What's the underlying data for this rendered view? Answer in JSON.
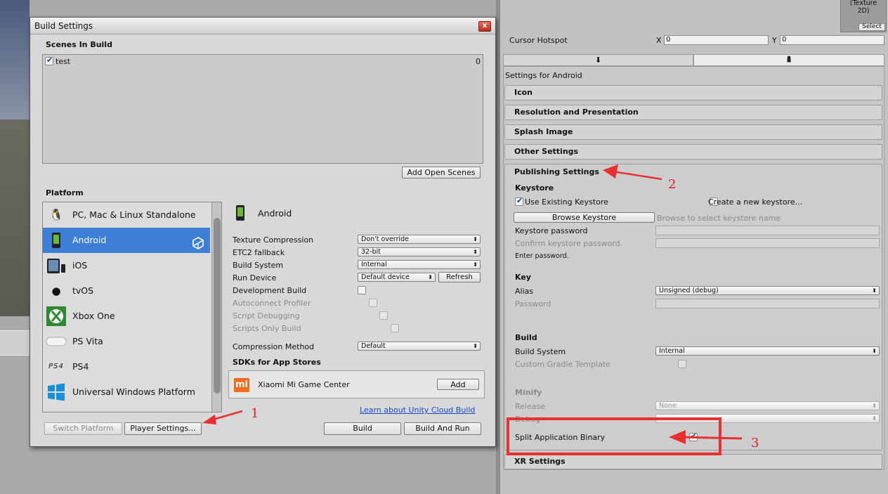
{
  "build_settings": {
    "window_title": "Build Settings",
    "close_label": "x",
    "scenes_header": "Scenes In Build",
    "scenes": [
      {
        "name": "test",
        "index": "0",
        "checked": true
      }
    ],
    "add_open_scenes_label": "Add Open Scenes",
    "platform_header": "Platform",
    "platforms": [
      {
        "label": "PC, Mac & Linux Standalone",
        "icon": "pc-standalone-icon"
      },
      {
        "label": "Android",
        "icon": "android-icon",
        "selected": true
      },
      {
        "label": "iOS",
        "icon": "ios-icon"
      },
      {
        "label": "tvOS",
        "icon": "tvos-icon"
      },
      {
        "label": "Xbox One",
        "icon": "xbox-icon"
      },
      {
        "label": "PS Vita",
        "icon": "ps-vita-icon"
      },
      {
        "label": "PS4",
        "icon": "ps4-icon"
      },
      {
        "label": "Universal Windows Platform",
        "icon": "windows-icon"
      }
    ],
    "selected_platform_title": "Android",
    "settings": [
      {
        "label": "Texture Compression",
        "value": "Don't override"
      },
      {
        "label": "ETC2 fallback",
        "value": "32-bit"
      },
      {
        "label": "Build System",
        "value": "Internal"
      },
      {
        "label": "Run Device",
        "value": "Default device"
      },
      {
        "label": "Development Build"
      },
      {
        "label": "Autoconnect Profiler"
      },
      {
        "label": "Script Debugging"
      },
      {
        "label": "Scripts Only Build"
      },
      {
        "label": "Compression Method",
        "value": "Default"
      }
    ],
    "refresh_label": "Refresh",
    "sdks_header": "SDKs for App Stores",
    "sdk_name": "Xiaomi Mi Game Center",
    "sdk_add_label": "Add",
    "cloud_build_link": "Learn about Unity Cloud Build",
    "switch_platform_label": "Switch Platform",
    "player_settings_label": "Player Settings...",
    "build_label": "Build",
    "build_and_run_label": "Build And Run"
  },
  "inspector": {
    "texture_badge_line1": "(Texture",
    "texture_badge_line2": "2D)",
    "select_label": "Select",
    "cursor_hotspot_label": "Cursor Hotspot",
    "x_label": "X",
    "x_value": "0",
    "y_label": "Y",
    "y_value": "0",
    "settings_for": "Settings for Android",
    "sections": [
      "Icon",
      "Resolution and Presentation",
      "Splash Image",
      "Other Settings"
    ],
    "publishing": {
      "title": "Publishing Settings",
      "keystore_header": "Keystore",
      "use_existing_label": "Use Existing Keystore",
      "create_new_label": "Create a new keystore...",
      "browse_label": "Browse Keystore",
      "browse_hint": "Browse to select keystore name",
      "keystore_password_label": "Keystore password",
      "confirm_password_label": "Confirm keystore password.",
      "enter_password_note": "Enter password.",
      "key_header": "Key",
      "alias_label": "Alias",
      "alias_value": "Unsigned (debug)",
      "password_label": "Password",
      "build_header": "Build",
      "build_system_label": "Build System",
      "build_system_value": "Internal",
      "custom_gradle_label": "Custom Gradle Template",
      "minify_header": "Minify",
      "release_label": "Release",
      "release_value": "None",
      "debug_label": "Debug",
      "split_binary_label": "Split Application Binary"
    },
    "xr_settings": "XR Settings"
  },
  "annotations": {
    "one": "1",
    "two": "2",
    "three": "3",
    "color": "#e83030"
  },
  "colors": {
    "selection": "#3d7fd6",
    "link": "#1a4ac8"
  }
}
